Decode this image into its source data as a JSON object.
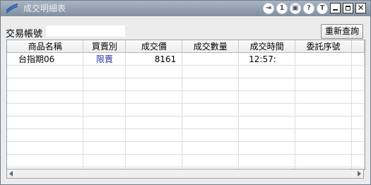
{
  "window": {
    "title": "成交明細表",
    "title_icons": [
      "⇥",
      "1",
      "▣",
      "?",
      "T"
    ],
    "window_buttons": {
      "close": "✕"
    }
  },
  "toolbar": {
    "account_label": "交易帳號",
    "account_value": "",
    "requery_label": "重新查詢"
  },
  "table": {
    "columns": [
      "商品名稱",
      "買賣別",
      "成交價",
      "成交數量",
      "成交時間",
      "委託序號"
    ],
    "rows": [
      [
        "台指期06",
        "限賣",
        "8161",
        "",
        "12:57:",
        ""
      ]
    ]
  },
  "colors": {
    "titlebar_top": "#a9b5c1",
    "titlebar_bottom": "#7f8fa0",
    "side_text": "#23329a"
  }
}
